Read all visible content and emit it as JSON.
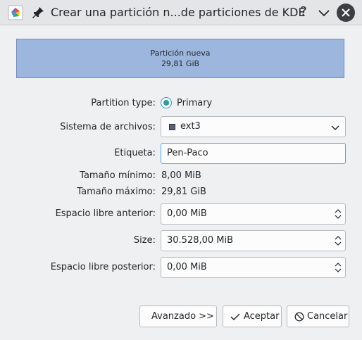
{
  "window": {
    "title": "Crear una partición n...de particiones de KDE",
    "help_glyph": "?"
  },
  "partition_preview": {
    "name": "Partición nueva",
    "size": "29,81 GiB",
    "fill_color": "#9cb6dd"
  },
  "form": {
    "partition_type_label": "Partition type:",
    "partition_type_value": "Primary",
    "filesystem_label": "Sistema de archivos:",
    "filesystem_value": "ext3",
    "label_label": "Etiqueta:",
    "label_value": "Pen-Paco",
    "min_size_label": "Tamaño mínimo:",
    "min_size_value": "8,00 MiB",
    "max_size_label": "Tamaño máximo:",
    "max_size_value": "29,81 GiB",
    "free_before_label": "Espacio libre anterior:",
    "free_before_value": "0,00 MiB",
    "size_label": "Size:",
    "size_value": "30.528,00 MiB",
    "free_after_label": "Espacio libre posterior:",
    "free_after_value": "0,00 MiB"
  },
  "buttons": {
    "advanced": "Avanzado >>",
    "accept": "Aceptar",
    "cancel": "Cancelar"
  },
  "colors": {
    "accent": "#3daee9",
    "radio_selected": "#2aa198"
  }
}
